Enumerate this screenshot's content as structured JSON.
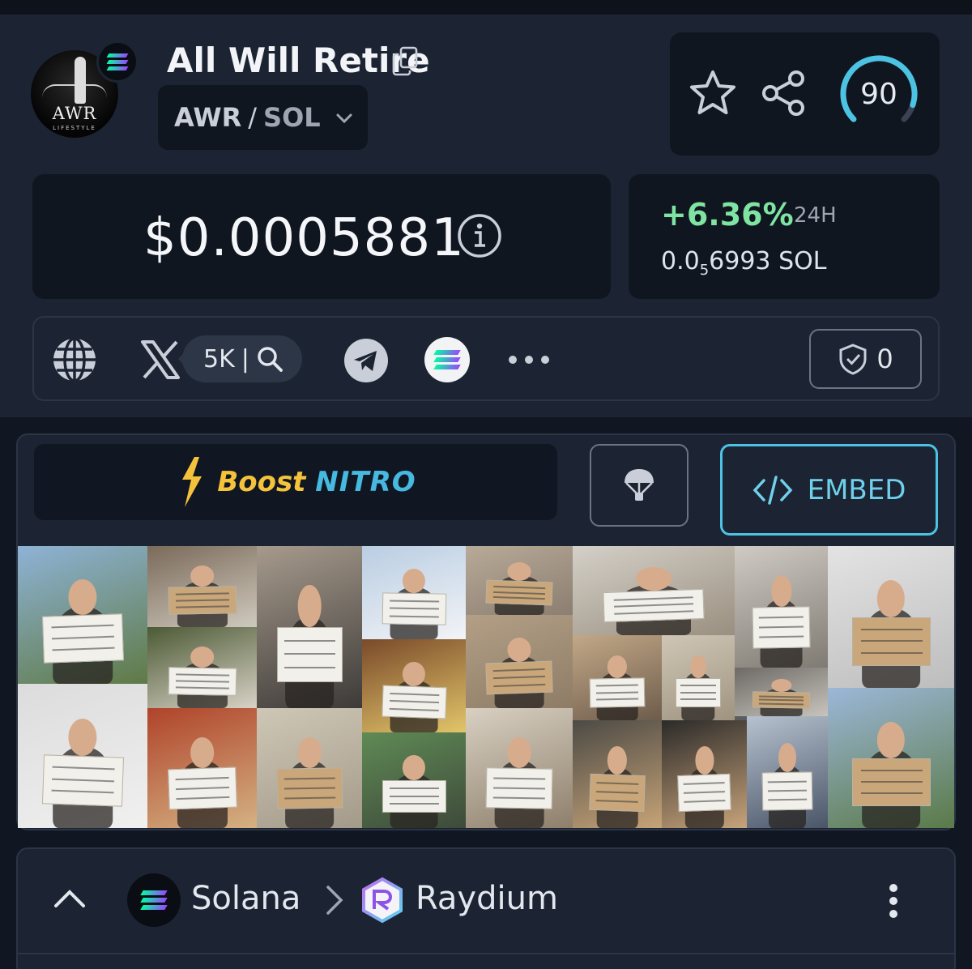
{
  "token": {
    "name": "All Will Retire",
    "logo_text": "AWR",
    "logo_subtext": "LIFESTYLE",
    "pair_base": "AWR",
    "pair_separator": "/",
    "pair_quote": "SOL"
  },
  "actions": {
    "trust_score": "90",
    "trust_score_fraction": 0.9
  },
  "price": {
    "usd": "$0.0005881",
    "change_24h": "+6.36%",
    "change_period": "24H",
    "native_prefix": "0.0",
    "native_subscript": "5",
    "native_digits": "6993",
    "native_unit": "SOL"
  },
  "links": {
    "x_followers": "5K",
    "audit_count": "0"
  },
  "promo": {
    "boost_word": "Boost",
    "nitro_word": "NITRO",
    "embed_label": "EMBED"
  },
  "breadcrumb": {
    "chain": "Solana",
    "dex": "Raydium"
  },
  "colors": {
    "background": "#1c2433",
    "card": "#101620",
    "positive": "#7fe3a2",
    "accent": "#4cc3e3",
    "boost_yellow": "#f5c33b",
    "nitro_blue": "#47b9e0"
  },
  "icons": [
    "solana-icon",
    "copy-icon",
    "chevron-down-icon",
    "star-icon",
    "share-icon",
    "info-icon",
    "globe-icon",
    "x-icon",
    "search-icon",
    "telegram-icon",
    "solscan-icon",
    "more-icon",
    "shield-check-icon",
    "bolt-icon",
    "parachute-icon",
    "code-icon",
    "chevron-up-icon",
    "chevron-right-icon",
    "raydium-icon",
    "kebab-icon"
  ]
}
